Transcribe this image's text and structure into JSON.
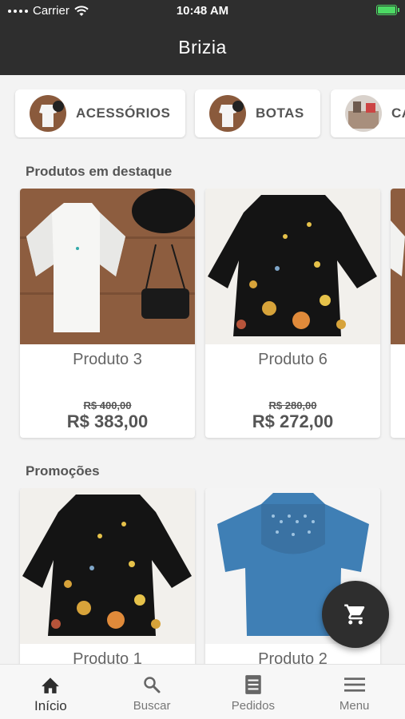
{
  "status_bar": {
    "carrier": "Carrier",
    "time": "10:48 AM"
  },
  "header": {
    "title": "Brizia"
  },
  "categories": [
    {
      "label": "ACESSÓRIOS",
      "icon": "dress-thumbnail"
    },
    {
      "label": "BOTAS",
      "icon": "dress-thumbnail"
    },
    {
      "label": "CA",
      "icon": "store-thumbnail"
    }
  ],
  "featured": {
    "title": "Produtos em destaque",
    "products": [
      {
        "name": "Produto 3",
        "old_price": "R$ 400,00",
        "price": "R$ 383,00",
        "image": "white-lace-romper"
      },
      {
        "name": "Produto 6",
        "old_price": "R$ 280,00",
        "price": "R$ 272,00",
        "image": "black-floral-romper"
      }
    ]
  },
  "promotions": {
    "title": "Promoções",
    "products": [
      {
        "name": "Produto 1",
        "image": "black-floral-romper"
      },
      {
        "name": "Produto 2",
        "image": "blue-lace-blouse"
      }
    ]
  },
  "fab": {
    "icon": "cart-icon"
  },
  "tabbar": {
    "items": [
      {
        "label": "Início",
        "icon": "home-icon",
        "active": true
      },
      {
        "label": "Buscar",
        "icon": "search-icon",
        "active": false
      },
      {
        "label": "Pedidos",
        "icon": "receipt-icon",
        "active": false
      },
      {
        "label": "Menu",
        "icon": "menu-icon",
        "active": false
      }
    ]
  },
  "colors": {
    "header_bg": "#2e2e2e",
    "battery": "#4cd964",
    "text": "#555555"
  }
}
